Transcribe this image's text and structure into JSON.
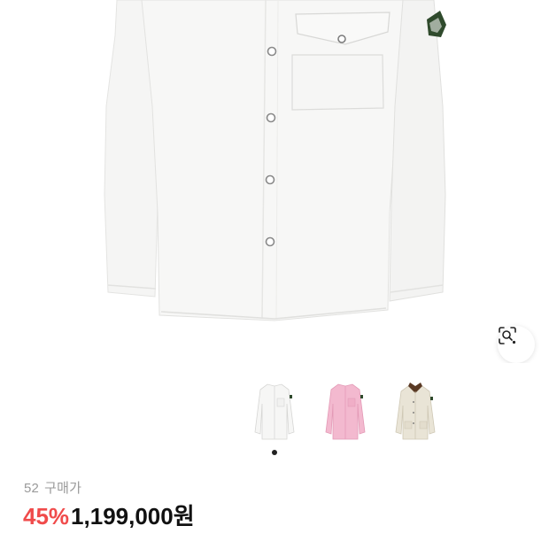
{
  "product": {
    "size": "52",
    "purchase_label": "구매가",
    "discount": "45%",
    "price": "1,199,000원"
  },
  "colors": {
    "discount": "#f04b4b",
    "price": "#111111",
    "meta": "#9a9a9a"
  },
  "thumbnails": [
    {
      "variant": "white-shirt-jacket"
    },
    {
      "variant": "pink-shirt-jacket"
    },
    {
      "variant": "beige-jacket-brown-collar"
    }
  ],
  "carousel": {
    "active_index": 1,
    "total": 1
  },
  "icons": {
    "lens": "visual-search-icon"
  }
}
